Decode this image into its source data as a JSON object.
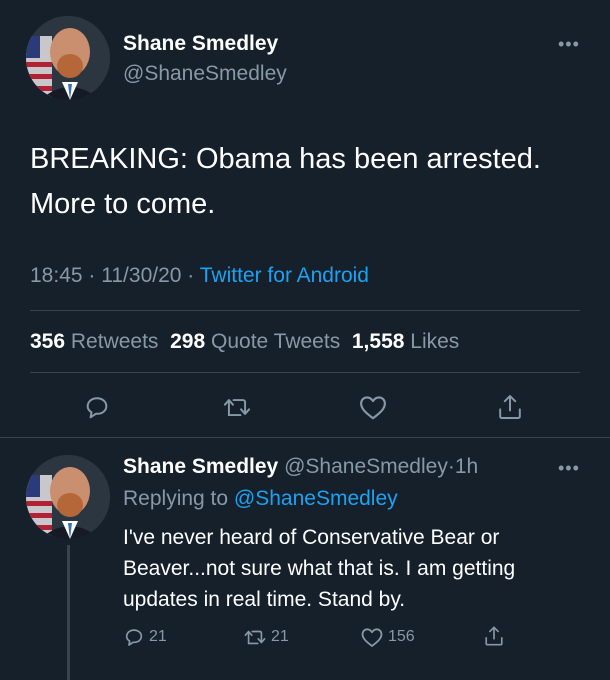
{
  "main_tweet": {
    "author_name": "Shane Smedley",
    "author_handle": "@ShaneSmedley",
    "text_line1": "BREAKING: Obama has been arrested.",
    "text_line2": "More to come.",
    "time": "18:45",
    "date": "11/30/20",
    "source": "Twitter for Android",
    "retweets_count": "356",
    "retweets_label": "Retweets",
    "quotes_count": "298",
    "quotes_label": "Quote Tweets",
    "likes_count": "1,558",
    "likes_label": "Likes"
  },
  "reply_tweet": {
    "author_name": "Shane Smedley",
    "author_handle": "@ShaneSmedley",
    "age": "1h",
    "replying_to_prefix": "Replying to",
    "replying_to_handle": "@ShaneSmedley",
    "text_line1": "I've never heard of Conservative Bear or",
    "text_line2": "Beaver...not sure what that is. I am getting",
    "text_line3": "updates in real time. Stand by.",
    "reply_count": "21",
    "retweet_count": "21",
    "like_count": "156"
  },
  "separator_dot": "·",
  "more_glyph": "•••",
  "colors": {
    "background": "#15202b",
    "text": "#ffffff",
    "secondary": "#8899a6",
    "accent": "#1da1f2",
    "divider": "#38444d"
  },
  "icons": [
    "reply-icon",
    "retweet-icon",
    "like-icon",
    "share-icon",
    "more-icon"
  ]
}
